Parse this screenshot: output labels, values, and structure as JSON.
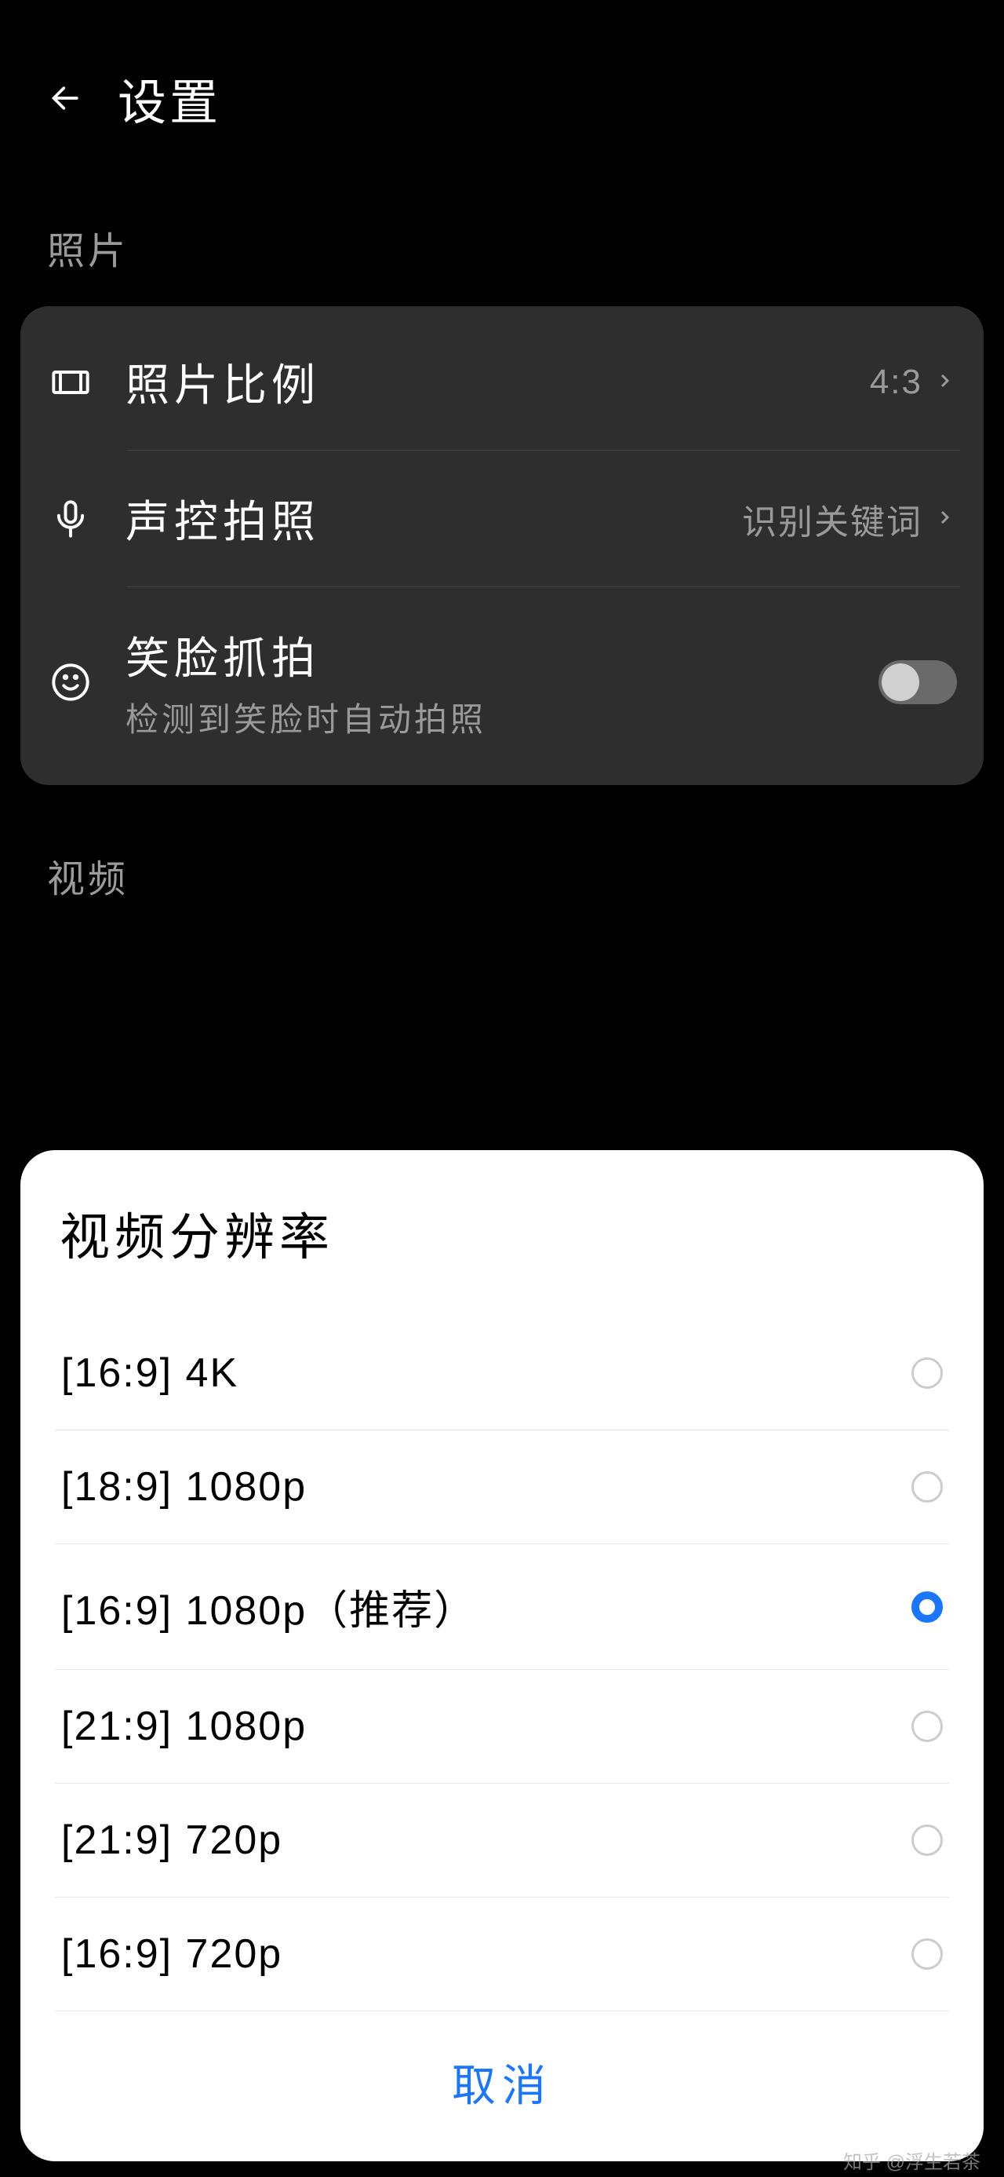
{
  "header": {
    "title": "设置"
  },
  "sections": {
    "photo": {
      "label": "照片",
      "items": {
        "ratio": {
          "title": "照片比例",
          "value": "4:3"
        },
        "voice": {
          "title": "声控拍照",
          "value": "识别关键词"
        },
        "smile": {
          "title": "笑脸抓拍",
          "subtitle": "检测到笑脸时自动拍照"
        }
      }
    },
    "video": {
      "label": "视频"
    }
  },
  "dialog": {
    "title": "视频分辨率",
    "options": [
      {
        "label": "[16:9]  4K",
        "selected": false
      },
      {
        "label": "[18:9]  1080p",
        "selected": false
      },
      {
        "label": "[16:9]  1080p（推荐）",
        "selected": true
      },
      {
        "label": "[21:9]  1080p",
        "selected": false
      },
      {
        "label": "[21:9]  720p",
        "selected": false
      },
      {
        "label": "[16:9]  720p",
        "selected": false
      }
    ],
    "cancel": "取消"
  },
  "watermark": "知乎 @浮生若茶"
}
